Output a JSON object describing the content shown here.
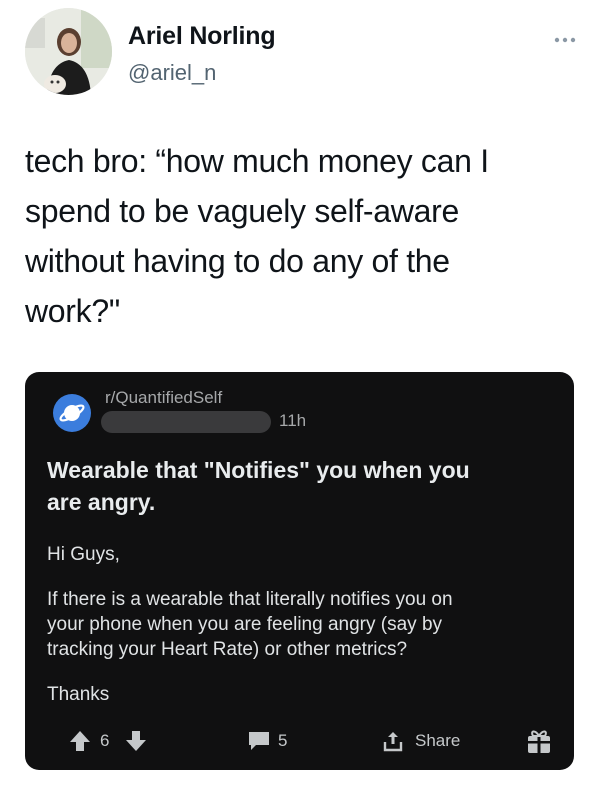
{
  "tweet": {
    "author_name": "Ariel Norling",
    "author_handle": "@ariel_n",
    "text_lines": [
      "tech bro: “how much money can I",
      "spend to be vaguely self-aware",
      "without having to do any of the",
      "work?\""
    ]
  },
  "reddit_post": {
    "subreddit": "r/QuantifiedSelf",
    "time": "11h",
    "title_lines": [
      "Wearable that \"Notifies\" you when you",
      "are angry."
    ],
    "body_greeting": "Hi Guys,",
    "body_question_lines": [
      "If there is a wearable that literally notifies you on",
      "your phone when you are feeling angry (say by",
      "tracking your Heart Rate) or other metrics?"
    ],
    "body_signoff": "Thanks",
    "vote_count": "6",
    "comment_count": "5",
    "share_label": "Share"
  },
  "colors": {
    "card_background": "#101011",
    "subreddit_icon": "#3b7ddd",
    "handle_text": "#536471"
  },
  "icons": {
    "more": "more-horizontal-icon",
    "upvote": "upvote-arrow-icon",
    "downvote": "downvote-arrow-icon",
    "comment": "comment-icon",
    "share": "share-icon",
    "award": "award-gift-icon",
    "subreddit": "planet-icon"
  }
}
